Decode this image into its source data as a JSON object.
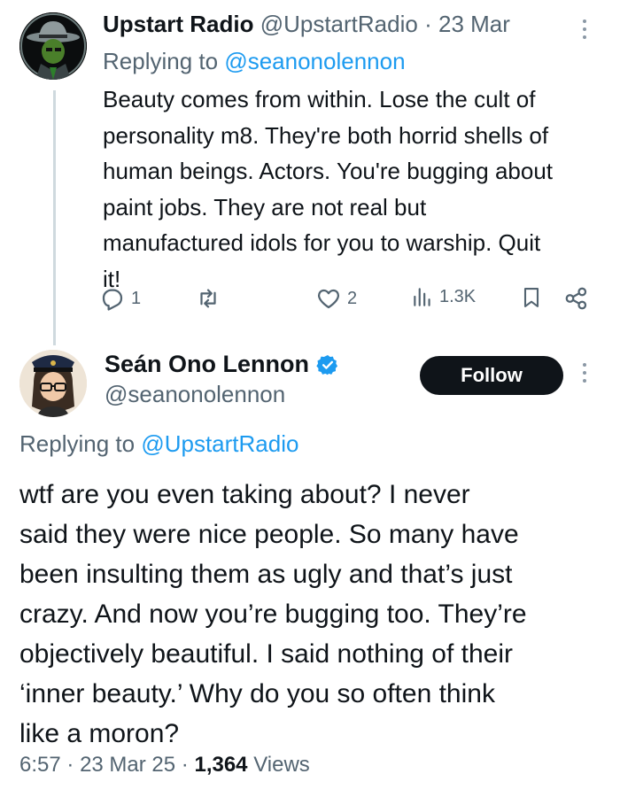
{
  "reply_tweet": {
    "display_name": "Upstart Radio",
    "handle": "@UpstartRadio",
    "separator": "·",
    "date": "23 Mar",
    "replying_prefix": "Replying to",
    "replying_to": "@seanonolennon",
    "body_lines": [
      "Beauty comes from within.  Lose the cult of",
      "personality m8.  They're both horrid shells of",
      "human beings.  Actors.  You're bugging about",
      "paint jobs. They are not real but",
      "manufactured idols for you to warship.  Quit",
      "it!"
    ],
    "actions": {
      "reply_count": "1",
      "like_count": "2",
      "views": "1.3K"
    }
  },
  "main_tweet": {
    "display_name": "Seán Ono Lennon",
    "handle": "@seanonolennon",
    "verified": true,
    "follow_label": "Follow",
    "replying_prefix": "Replying to",
    "replying_to": "@UpstartRadio",
    "body_lines": [
      "wtf are you even taking about? I never",
      "said they were nice people. So many have",
      "been insulting them as ugly and that’s just",
      "crazy. And now you’re bugging too. They’re",
      "objectively beautiful. I said nothing of their",
      "‘inner beauty.’ Why do you so often think",
      "like a moron?"
    ],
    "time": "6:57",
    "date": "23 Mar 25",
    "separator": "·",
    "views_count": "1,364",
    "views_label": "Views"
  },
  "icons": {
    "reply": "reply-icon",
    "repost": "repost-icon",
    "like": "like-icon",
    "views": "views-icon",
    "bookmark": "bookmark-icon",
    "share": "share-icon",
    "verified": "verified-badge-icon",
    "more": "more-icon"
  },
  "colors": {
    "link": "#1d9bf0",
    "secondary_text": "#536471",
    "follow_button": "#0f1419",
    "verified": "#1d9bf0"
  }
}
